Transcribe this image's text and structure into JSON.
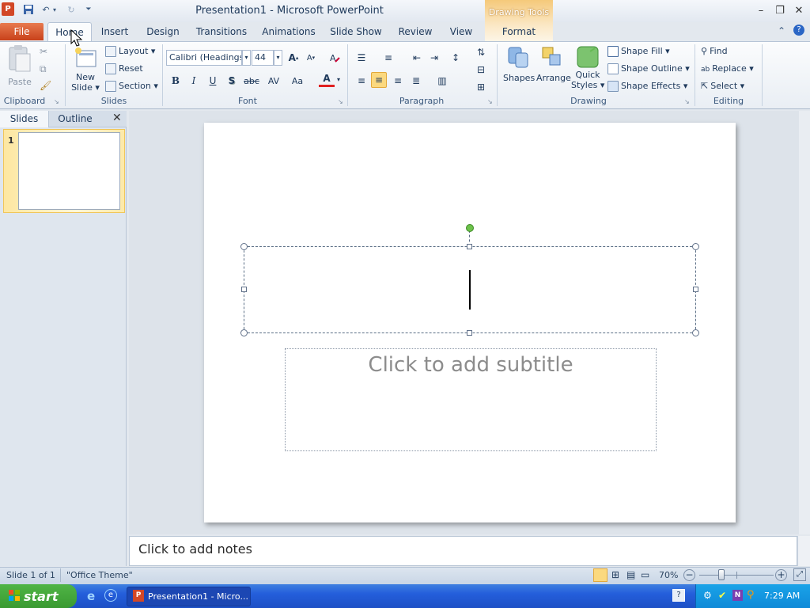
{
  "window": {
    "title": "Presentation1 - Microsoft PowerPoint",
    "app_icon_letter": "P",
    "contextual_group": "Drawing Tools"
  },
  "tabs": [
    "File",
    "Home",
    "Insert",
    "Design",
    "Transitions",
    "Animations",
    "Slide Show",
    "Review",
    "View",
    "Format"
  ],
  "ribbon": {
    "clipboard": {
      "label": "Clipboard",
      "paste": "Paste"
    },
    "slides": {
      "label": "Slides",
      "new_slide_1": "New",
      "new_slide_2": "Slide ▾",
      "layout": "Layout ▾",
      "reset": "Reset",
      "section": "Section ▾"
    },
    "font": {
      "label": "Font",
      "name": "Calibri (Headings",
      "size": "44",
      "bold": "B",
      "italic": "I",
      "underline": "U",
      "shadow": "S",
      "strike": "abc",
      "spacing": "AV",
      "case": "Aa",
      "color": "A"
    },
    "paragraph": {
      "label": "Paragraph"
    },
    "drawing": {
      "label": "Drawing",
      "shapes": "Shapes",
      "arrange": "Arrange",
      "quick_styles_1": "Quick",
      "quick_styles_2": "Styles ▾",
      "shape_fill": "Shape Fill ▾",
      "shape_outline": "Shape Outline ▾",
      "shape_effects": "Shape Effects ▾"
    },
    "editing": {
      "label": "Editing",
      "find": "Find",
      "replace": "Replace ▾",
      "select": "Select ▾"
    }
  },
  "left_pane": {
    "tab_slides": "Slides",
    "tab_outline": "Outline",
    "slide_number": "1"
  },
  "slide": {
    "subtitle_placeholder": "Click to add subtitle"
  },
  "notes": {
    "placeholder": "Click to add notes"
  },
  "status": {
    "slide_info": "Slide 1 of 1",
    "theme": "\"Office Theme\"",
    "zoom": "70%",
    "zoom_level": 70
  },
  "taskbar": {
    "start": "start",
    "item": "Presentation1 - Micro...",
    "clock": "7:29 AM"
  },
  "colors": {
    "file_tab": "#d24726",
    "accent": "#2b579a",
    "taskbar": "#245edb",
    "start": "#3a9a31",
    "context": "#f5c97a"
  }
}
